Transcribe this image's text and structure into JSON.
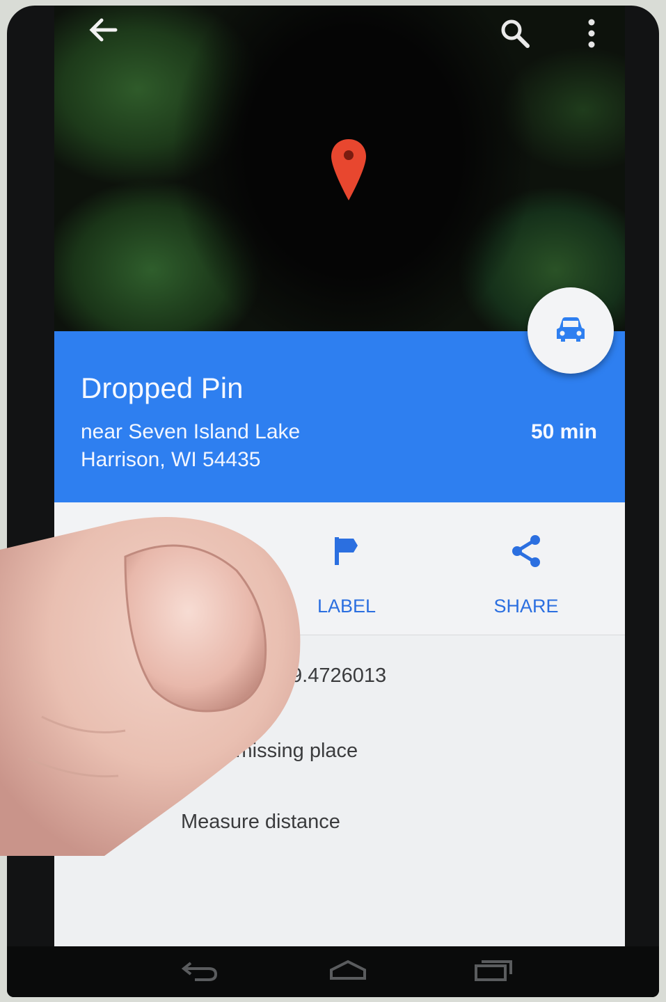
{
  "colors": {
    "accent_blue": "#2e7ff0",
    "action_blue": "#2b6fe0",
    "pin_red": "#e8472f",
    "card_bg": "#f2f3f5"
  },
  "toolbar": {
    "back_icon": "arrow-left-icon",
    "search_icon": "search-icon",
    "more_icon": "more-vert-icon"
  },
  "map": {
    "pin_icon": "map-pin-icon"
  },
  "fab": {
    "icon": "car-icon"
  },
  "place": {
    "title": "Dropped Pin",
    "address_line1": "near Seven Island Lake",
    "address_line2": "Harrison, WI 54435",
    "drive_time": "50 min"
  },
  "actions": [
    {
      "label": "LABEL",
      "icon": "flag-icon"
    },
    {
      "label": "SHARE",
      "icon": "share-icon"
    }
  ],
  "details": [
    {
      "text": "6, -89.4726013",
      "icon": "location-icon"
    },
    {
      "text": "dd a missing place",
      "icon": "add-place-icon"
    },
    {
      "text": "Measure distance",
      "icon": "ruler-icon"
    }
  ],
  "navigation": {
    "back_icon": "nav-back-icon",
    "home_icon": "nav-home-icon",
    "recent_icon": "nav-recent-icon"
  }
}
